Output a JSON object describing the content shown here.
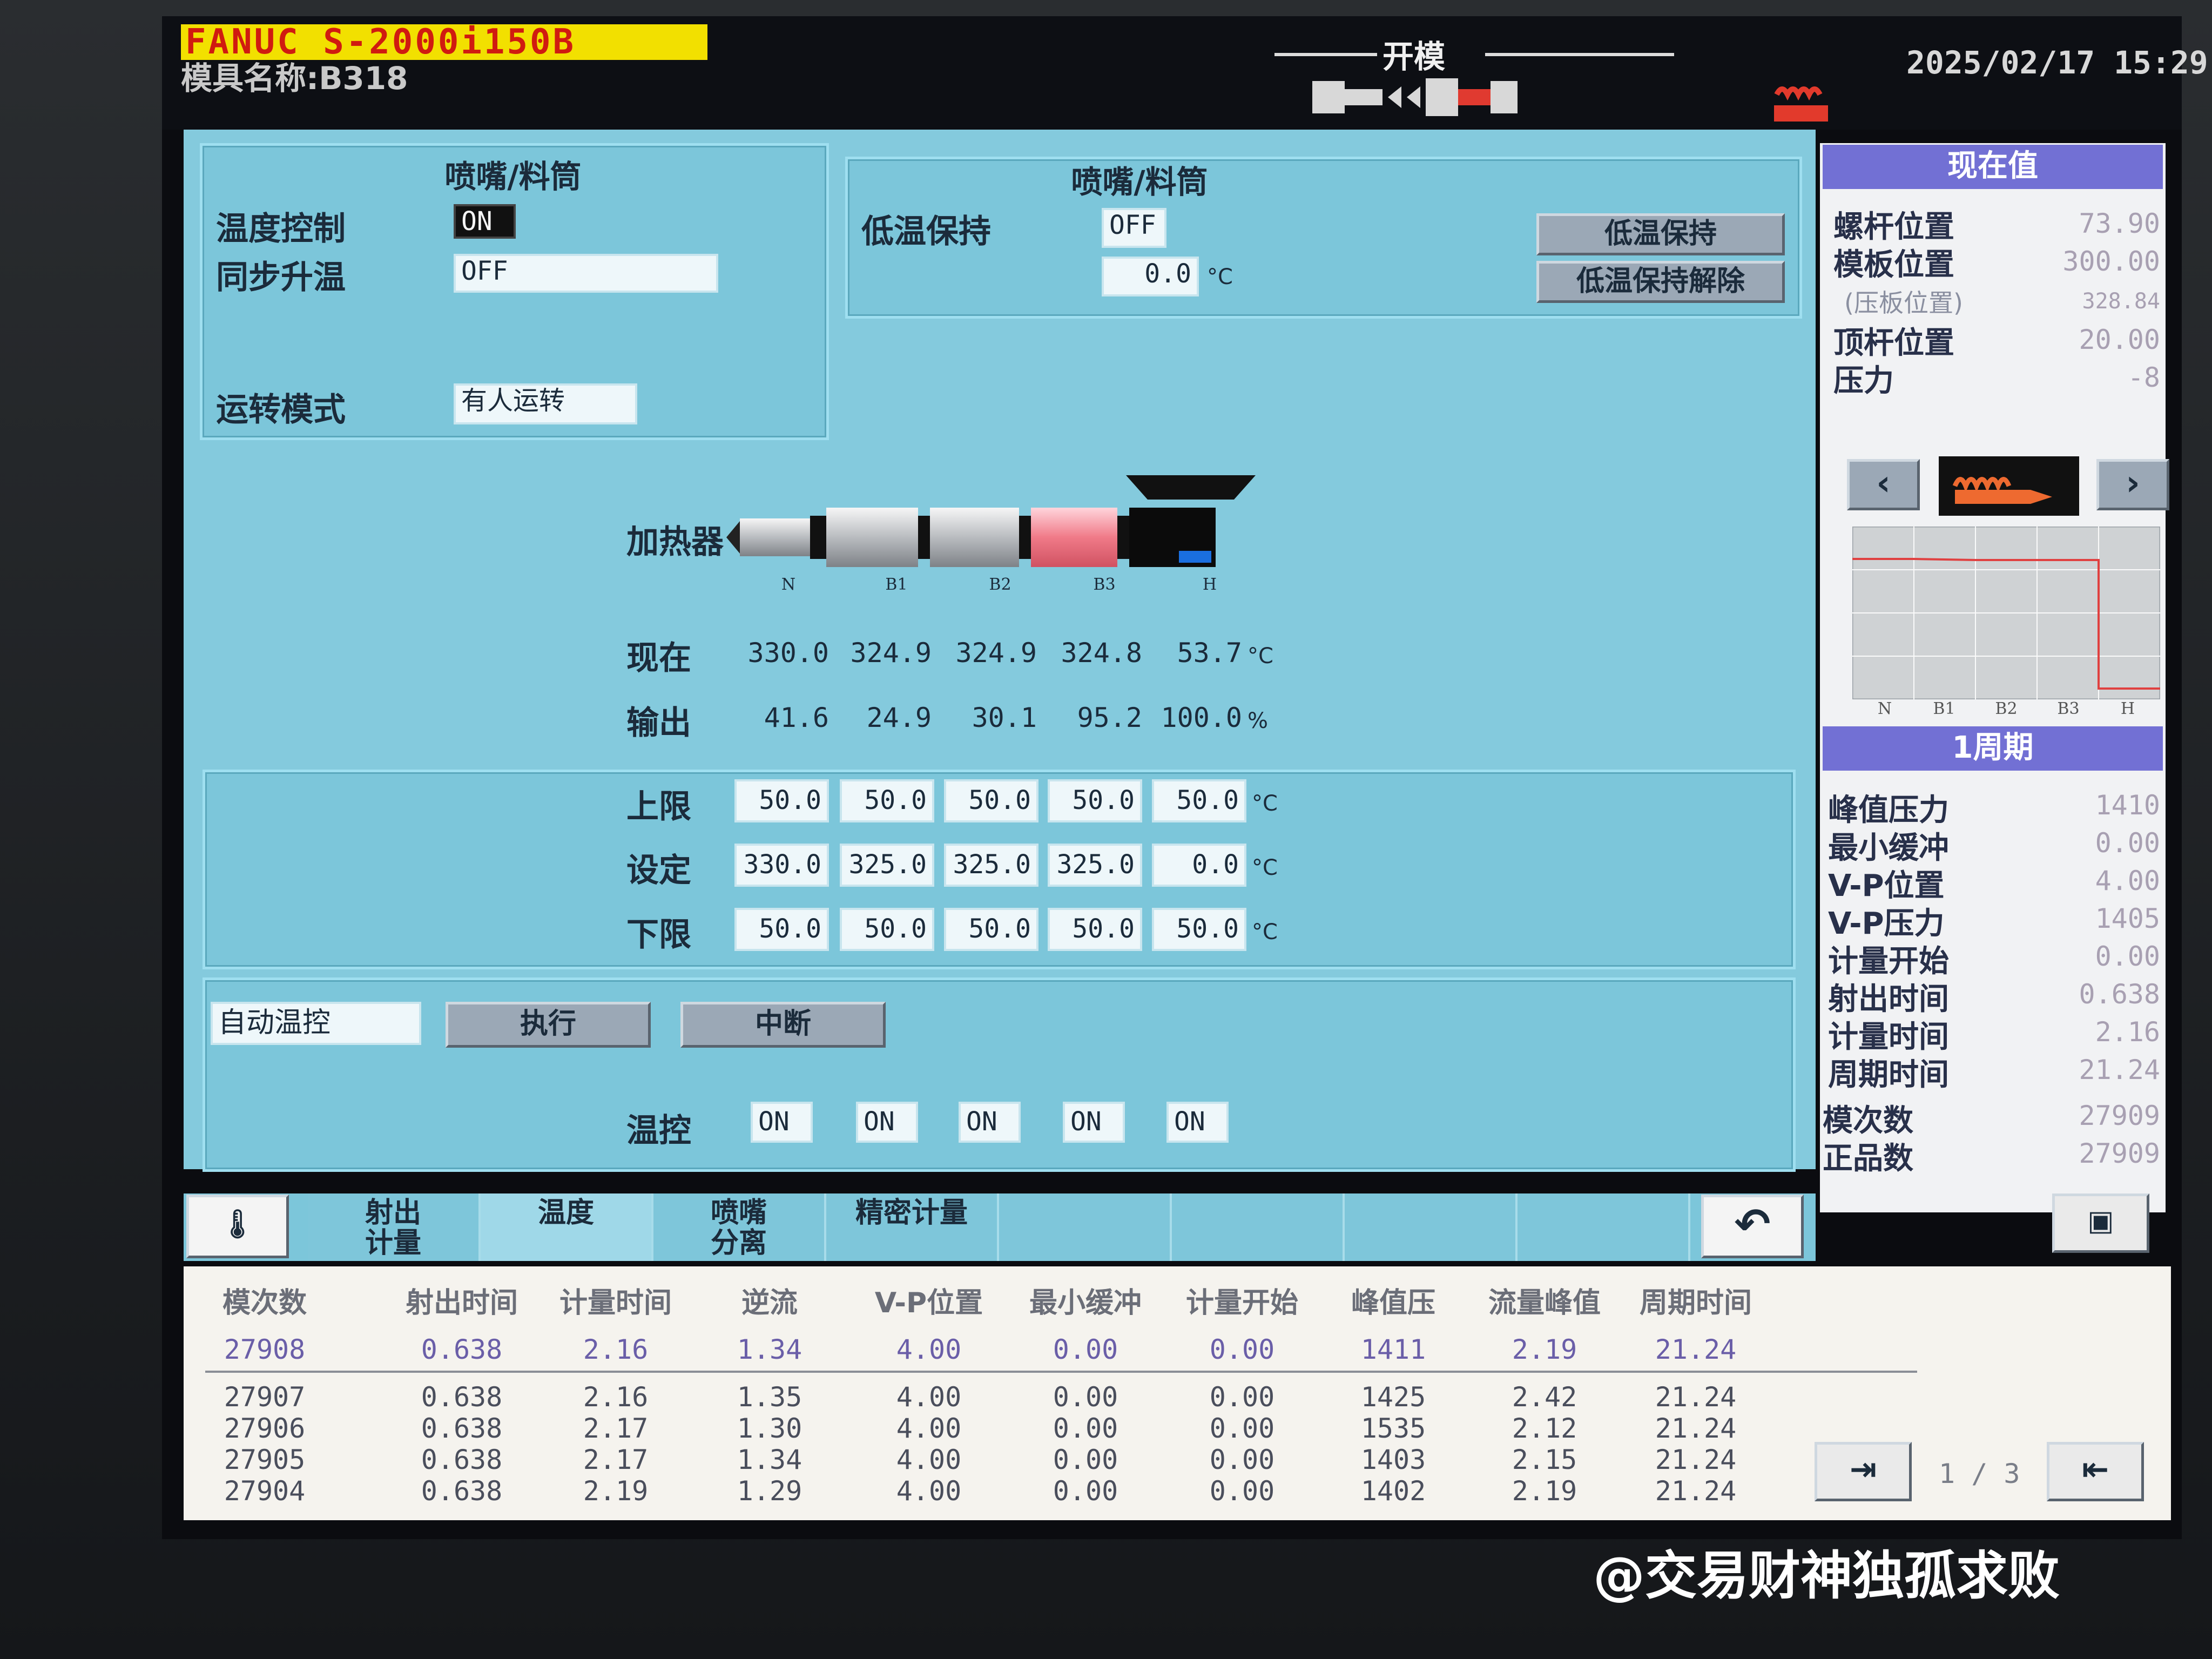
{
  "header": {
    "brand": "FANUC  S-2000i150B",
    "mold_name": "模具名称:B318",
    "operation_mode": "开模",
    "datetime": "2025/02/17 15:29"
  },
  "nozzle_panel_left": {
    "title": "喷嘴/料筒",
    "temp_control_label": "温度控制",
    "temp_control_value": "ON",
    "sync_heat_label": "同步升温",
    "sync_heat_value": "OFF",
    "run_mode_label": "运转模式",
    "run_mode_value": "有人运转"
  },
  "nozzle_panel_right": {
    "title": "喷嘴/料筒",
    "low_temp_hold_label": "低温保持",
    "low_temp_hold_value": "OFF",
    "low_temp_value": "0.0",
    "unit": "°C",
    "btn_low_temp_hold": "低温保持",
    "btn_low_temp_release": "低温保持解除"
  },
  "heater": {
    "label": "加热器",
    "zones": [
      "N",
      "B1",
      "B2",
      "B3",
      "H"
    ],
    "current_label": "现在",
    "current": [
      "330.0",
      "324.9",
      "324.9",
      "324.8",
      "53.7"
    ],
    "current_unit": "°C",
    "output_label": "输出",
    "output": [
      "41.6",
      "24.9",
      "30.1",
      "95.2",
      "100.0"
    ],
    "output_unit": "%"
  },
  "limits": {
    "upper_label": "上限",
    "upper": [
      "50.0",
      "50.0",
      "50.0",
      "50.0",
      "50.0"
    ],
    "set_label": "设定",
    "set": [
      "330.0",
      "325.0",
      "325.0",
      "325.0",
      "0.0"
    ],
    "lower_label": "下限",
    "lower": [
      "50.0",
      "50.0",
      "50.0",
      "50.0",
      "50.0"
    ],
    "unit": "°C"
  },
  "auto_control": {
    "select_value": "自动温控",
    "execute": "执行",
    "abort": "中断",
    "temp_ctrl_label": "温控",
    "temp_ctrl": [
      "ON",
      "ON",
      "ON",
      "ON",
      "ON"
    ]
  },
  "current_values": {
    "title": "现在值",
    "items": [
      {
        "label": "螺杆位置",
        "value": "73.90"
      },
      {
        "label": "模板位置",
        "value": "300.00"
      },
      {
        "label": "(压板位置)",
        "value": "328.84"
      },
      {
        "label": "顶杆位置",
        "value": "20.00"
      },
      {
        "label": "压力",
        "value": "-8"
      }
    ],
    "graph_zones": [
      "N",
      "B1",
      "B2",
      "B3",
      "H"
    ]
  },
  "cycle": {
    "title": "1周期",
    "items": [
      {
        "label": "峰值压力",
        "value": "1410"
      },
      {
        "label": "最小缓冲",
        "value": "0.00"
      },
      {
        "label": "V-P位置",
        "value": "4.00"
      },
      {
        "label": "V-P压力",
        "value": "1405"
      },
      {
        "label": "计量开始",
        "value": "0.00"
      },
      {
        "label": "射出时间",
        "value": "0.638"
      },
      {
        "label": "计量时间",
        "value": "2.16"
      },
      {
        "label": "周期时间",
        "value": "21.24"
      },
      {
        "label": "模次数",
        "value": "27909"
      },
      {
        "label": "正品数",
        "value": "27909"
      }
    ]
  },
  "tabs": [
    {
      "label": "射出\n计量"
    },
    {
      "label": "温度"
    },
    {
      "label": "喷嘴\n分离"
    },
    {
      "label": "精密计量"
    }
  ],
  "table": {
    "headers": [
      "模次数",
      "射出时间",
      "计量时间",
      "逆流",
      "V-P位置",
      "最小缓冲",
      "计量开始",
      "峰值压",
      "流量峰值",
      "周期时间"
    ],
    "latest": [
      "27908",
      "0.638",
      "2.16",
      "1.34",
      "4.00",
      "0.00",
      "0.00",
      "1411",
      "2.19",
      "21.24"
    ],
    "rows": [
      [
        "27907",
        "0.638",
        "2.16",
        "1.35",
        "4.00",
        "0.00",
        "0.00",
        "1425",
        "2.42",
        "21.24"
      ],
      [
        "27906",
        "0.638",
        "2.17",
        "1.30",
        "4.00",
        "0.00",
        "0.00",
        "1535",
        "2.12",
        "21.24"
      ],
      [
        "27905",
        "0.638",
        "2.17",
        "1.34",
        "4.00",
        "0.00",
        "0.00",
        "1403",
        "2.15",
        "21.24"
      ],
      [
        "27904",
        "0.638",
        "2.19",
        "1.29",
        "4.00",
        "0.00",
        "0.00",
        "1402",
        "2.19",
        "21.24"
      ]
    ],
    "page": "1 / 3"
  },
  "watermark": "@交易财神独孤求败",
  "colors": {
    "panel": "#84cadd",
    "side_header": "#7270d4",
    "heater_hot": "#f07a88",
    "brand_bg": "#f2e000",
    "brand_text": "#d01b10"
  }
}
